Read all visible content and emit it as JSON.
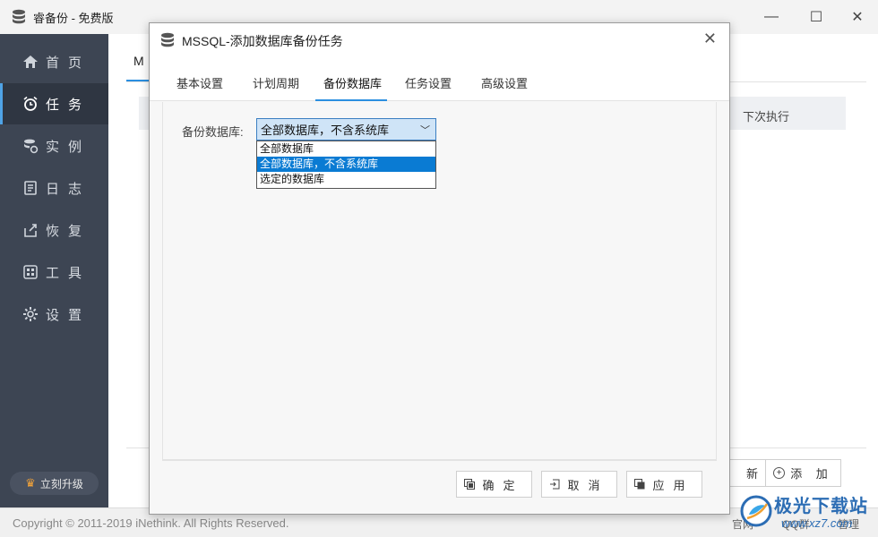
{
  "app": {
    "title": "睿备份 - 免费版",
    "window_controls": {
      "minimize": "—",
      "maximize": "☐",
      "close": "✕"
    }
  },
  "sidebar": {
    "items": [
      {
        "label": "首页",
        "icon": "home-icon"
      },
      {
        "label": "任务",
        "icon": "alarm-clock-icon",
        "active": true
      },
      {
        "label": "实例",
        "icon": "database-settings-icon"
      },
      {
        "label": "日志",
        "icon": "log-icon"
      },
      {
        "label": "恢复",
        "icon": "restore-icon"
      },
      {
        "label": "工具",
        "icon": "tools-grid-icon"
      },
      {
        "label": "设置",
        "icon": "gear-icon"
      }
    ],
    "upgrade_label": "立刻升级",
    "upgrade_icon": "crown-icon"
  },
  "content": {
    "tab_label": "M",
    "table_header_next_exec": "下次执行",
    "refresh_label": "新",
    "add_label": "添 加"
  },
  "status": {
    "copyright": "Copyright © 2011-2019 iNethink. All Rights Reserved.",
    "link1": "官网",
    "link2": "QQ群",
    "link3": "管理"
  },
  "watermark": {
    "text": "极光下载站",
    "url": "www.xz7.com"
  },
  "dialog": {
    "title": "MSSQL-添加数据库备份任务",
    "close": "✕",
    "tabs": [
      {
        "label": "基本设置"
      },
      {
        "label": "计划周期"
      },
      {
        "label": "备份数据库",
        "active": true
      },
      {
        "label": "任务设置"
      },
      {
        "label": "高级设置"
      }
    ],
    "backup_db_label": "备份数据库:",
    "backup_db_value": "全部数据库，不含系统库",
    "options": [
      "全部数据库",
      "全部数据库，不含系统库",
      "选定的数据库"
    ],
    "selected_option_index": 1,
    "buttons": {
      "ok": "确定",
      "cancel": "取消",
      "apply": "应用"
    }
  },
  "colors": {
    "sidebar_bg": "#3d4553",
    "accent": "#2b8fe0",
    "selected_option": "#0a7bd3"
  }
}
